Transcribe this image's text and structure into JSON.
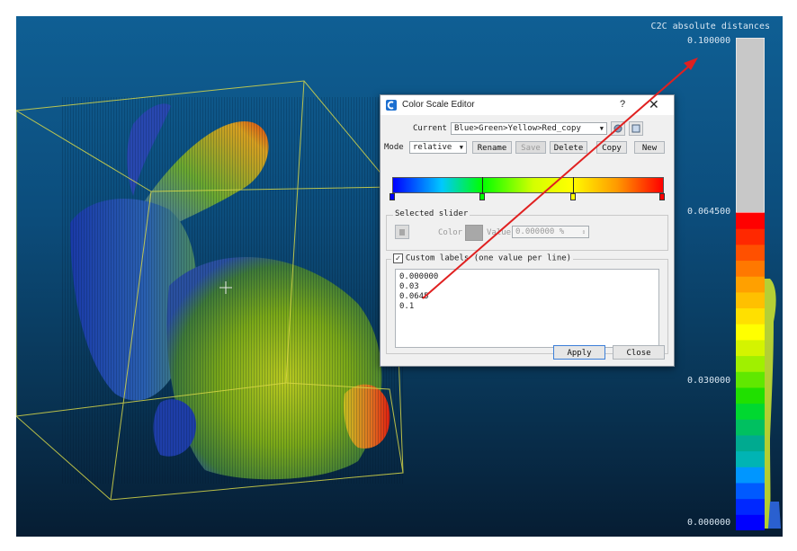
{
  "scale": {
    "title": "C2C absolute distances",
    "labels": [
      "0.100000",
      "0.064500",
      "0.030000",
      "0.000000"
    ],
    "values": [
      0.1,
      0.0645,
      0.03,
      0.0
    ],
    "colors": [
      "#0000ff",
      "#0028ff",
      "#005aff",
      "#0096ff",
      "#00b4b4",
      "#00aa90",
      "#00c060",
      "#00d830",
      "#20e000",
      "#60e800",
      "#a0f000",
      "#d4f400",
      "#ffff00",
      "#ffe000",
      "#ffc000",
      "#ffa000",
      "#ff7800",
      "#ff5000",
      "#ff2800",
      "#ff0000"
    ],
    "upper_color": "#c8c8c8"
  },
  "dialog": {
    "title": "Color Scale Editor",
    "help": "?",
    "close_glyph": "✕",
    "current_label": "Current",
    "current_value": "Blue>Green>Yellow>Red_copy",
    "mode_label": "Mode",
    "mode_value": "relative",
    "buttons": {
      "rename": "Rename",
      "save": "Save",
      "delete": "Delete",
      "copy": "Copy",
      "new": "New",
      "apply": "Apply",
      "close": "Close"
    },
    "selected_slider": {
      "title": "Selected slider",
      "color_label": "Color",
      "value_label": "Value",
      "value": "0.000000 %"
    },
    "custom_labels": {
      "checked": true,
      "label": "Custom labels (one value per line)",
      "lines": [
        "0.000000",
        "0.03",
        "0.0645",
        "0.1"
      ]
    }
  },
  "colors": {
    "accent_arrow": "#e02020",
    "bbox": "#d8d848"
  }
}
